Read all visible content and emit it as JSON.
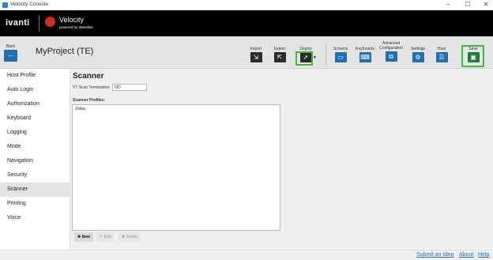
{
  "window": {
    "title": "Velocity Console",
    "controls": {
      "minimize": "–",
      "maximize": "☐",
      "close": "✕"
    }
  },
  "brand": {
    "ivanti": "ivanti",
    "product": "Velocity",
    "tagline": "powered by Wavelink"
  },
  "toolbar": {
    "back_label": "Back",
    "project_title": "MyProject (TE)",
    "items": [
      {
        "label": "Import",
        "icon": "import-icon"
      },
      {
        "label": "Export",
        "icon": "export-icon"
      },
      {
        "label": "Deploy",
        "icon": "rocket-icon"
      },
      {
        "label": "Screens",
        "icon": "screens-icon"
      },
      {
        "label": "Keyboards",
        "icon": "keyboard-icon"
      },
      {
        "label": "Advanced\nConfiguration",
        "icon": "advanced-config-icon"
      },
      {
        "label": "Settings",
        "icon": "gear-icon"
      },
      {
        "label": "Host",
        "icon": "host-icon"
      },
      {
        "label": "Save",
        "icon": "save-icon"
      }
    ],
    "highlight_color": "#3cba3c"
  },
  "sidebar": {
    "items": [
      {
        "label": "Host Profile"
      },
      {
        "label": "Auto Login"
      },
      {
        "label": "Authorization"
      },
      {
        "label": "Keyboard"
      },
      {
        "label": "Logging"
      },
      {
        "label": "Mode"
      },
      {
        "label": "Navigation"
      },
      {
        "label": "Security"
      },
      {
        "label": "Scanner",
        "active": true
      },
      {
        "label": "Printing"
      },
      {
        "label": "Voice"
      }
    ]
  },
  "main": {
    "title": "Scanner",
    "termination_label": "VT Scan Termination:",
    "termination_value": "\\0D",
    "profiles_label": "Scanner Profiles:",
    "profiles": [
      "Zebra"
    ],
    "buttons": {
      "new": "New",
      "edit": "Edit",
      "delete": "Delete"
    }
  },
  "footer": {
    "submit_idea": "Submit an Idea",
    "about": "About",
    "help": "Help"
  },
  "colors": {
    "accent": "#1f6fb5",
    "brand_bar": "#000000",
    "velocity_red": "#d52b1e"
  }
}
